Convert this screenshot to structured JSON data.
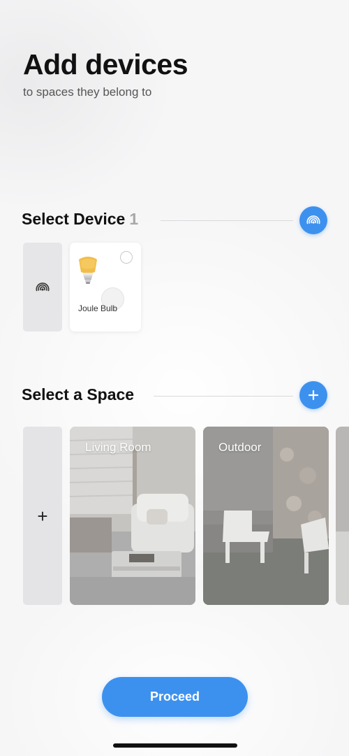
{
  "header": {
    "title": "Add devices",
    "subtitle": "to spaces they belong to"
  },
  "device_section": {
    "title": "Select Device",
    "count": "1",
    "scan_icon": "wireless-scan-icon",
    "devices": [
      {
        "name": "Joule Bulb",
        "icon": "light-bulb-icon",
        "selected": false
      }
    ]
  },
  "space_section": {
    "title": "Select a Space",
    "add_icon": "plus-icon",
    "add_tile_label": "+",
    "spaces": [
      {
        "label": "Living Room"
      },
      {
        "label": "Outdoor"
      }
    ]
  },
  "footer": {
    "proceed_label": "Proceed"
  },
  "colors": {
    "accent": "#3d91ee",
    "background": "#f6f6f7",
    "text": "#111111",
    "muted": "#a8a8ab"
  }
}
